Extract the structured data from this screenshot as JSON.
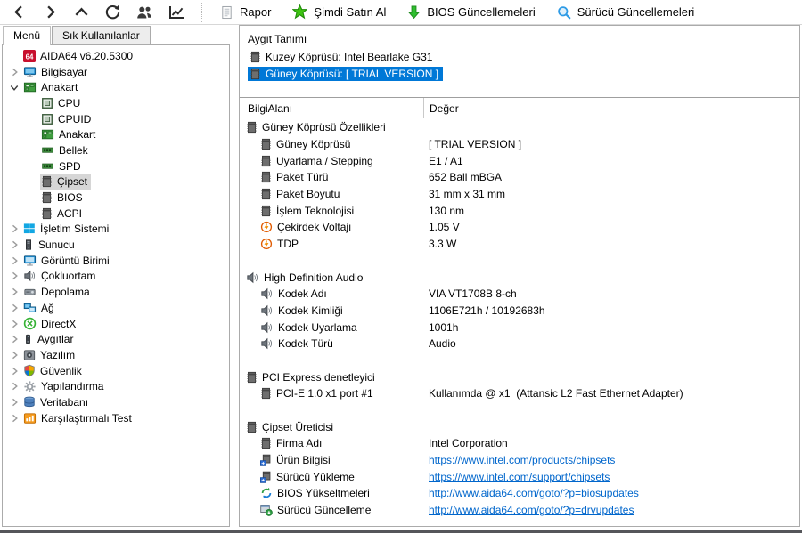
{
  "colors": {
    "accent": "#0078d7",
    "link": "#0066cc",
    "selection_inactive": "#d6d6d6"
  },
  "toolbar": {
    "nav_icons": [
      {
        "name": "back"
      },
      {
        "name": "forward"
      },
      {
        "name": "up"
      },
      {
        "name": "refresh"
      },
      {
        "name": "users"
      },
      {
        "name": "chart"
      }
    ],
    "buttons": [
      {
        "name": "report-button",
        "icon": "report",
        "label": "Rapor"
      },
      {
        "name": "buy-now-button",
        "icon": "buy",
        "label": "Şimdi Satın Al"
      },
      {
        "name": "bios-updates-button",
        "icon": "download",
        "label": "BIOS Güncellemeleri"
      },
      {
        "name": "driver-updates-button",
        "icon": "search",
        "label": "Sürücü Güncellemeleri"
      }
    ]
  },
  "sidebar": {
    "tabs": [
      {
        "label": "Menü",
        "active": true
      },
      {
        "label": "Sık Kullanılanlar",
        "active": false
      }
    ],
    "tree": [
      {
        "label": "AIDA64 v6.20.5300",
        "icon": "aida64",
        "level": 0,
        "expander": "none"
      },
      {
        "label": "Bilgisayar",
        "icon": "computer",
        "level": 0,
        "expander": "collapsed"
      },
      {
        "label": "Anakart",
        "icon": "motherboard",
        "level": 0,
        "expander": "expanded"
      },
      {
        "label": "CPU",
        "icon": "cpu",
        "level": 1,
        "expander": "none"
      },
      {
        "label": "CPUID",
        "icon": "cpu",
        "level": 1,
        "expander": "none"
      },
      {
        "label": "Anakart",
        "icon": "motherboard",
        "level": 1,
        "expander": "none"
      },
      {
        "label": "Bellek",
        "icon": "memory",
        "level": 1,
        "expander": "none"
      },
      {
        "label": "SPD",
        "icon": "memory",
        "level": 1,
        "expander": "none"
      },
      {
        "label": "Çipset",
        "icon": "chip",
        "level": 1,
        "expander": "none",
        "selected": true
      },
      {
        "label": "BIOS",
        "icon": "chip",
        "level": 1,
        "expander": "none"
      },
      {
        "label": "ACPI",
        "icon": "chip",
        "level": 1,
        "expander": "none"
      },
      {
        "label": "İşletim Sistemi",
        "icon": "windows",
        "level": 0,
        "expander": "collapsed"
      },
      {
        "label": "Sunucu",
        "icon": "server",
        "level": 0,
        "expander": "collapsed"
      },
      {
        "label": "Görüntü Birimi",
        "icon": "display",
        "level": 0,
        "expander": "collapsed"
      },
      {
        "label": "Çokluortam",
        "icon": "speaker",
        "level": 0,
        "expander": "collapsed"
      },
      {
        "label": "Depolama",
        "icon": "storage",
        "level": 0,
        "expander": "collapsed"
      },
      {
        "label": "Ağ",
        "icon": "network",
        "level": 0,
        "expander": "collapsed"
      },
      {
        "label": "DirectX",
        "icon": "directx",
        "level": 0,
        "expander": "collapsed"
      },
      {
        "label": "Aygıtlar",
        "icon": "devices",
        "level": 0,
        "expander": "collapsed"
      },
      {
        "label": "Yazılım",
        "icon": "software",
        "level": 0,
        "expander": "collapsed"
      },
      {
        "label": "Güvenlik",
        "icon": "security",
        "level": 0,
        "expander": "collapsed"
      },
      {
        "label": "Yapılandırma",
        "icon": "config",
        "level": 0,
        "expander": "collapsed"
      },
      {
        "label": "Veritabanı",
        "icon": "database",
        "level": 0,
        "expander": "collapsed"
      },
      {
        "label": "Karşılaştırmalı Test",
        "icon": "benchmark",
        "level": 0,
        "expander": "collapsed"
      }
    ]
  },
  "main": {
    "device_header": "Aygıt Tanımı",
    "devices": [
      {
        "icon": "chip",
        "label": "Kuzey Köprüsü: Intel Bearlake G31",
        "selected": false
      },
      {
        "icon": "chip",
        "label": "Güney Köprüsü: [ TRIAL VERSION ]",
        "selected": true
      }
    ],
    "columns": [
      "BilgiAlanı",
      "Değer"
    ],
    "sections": [
      {
        "icon": "chip",
        "title": "Güney Köprüsü Özellikleri",
        "rows": [
          {
            "icon": "chip",
            "label": "Güney Köprüsü",
            "value": "[ TRIAL VERSION ]"
          },
          {
            "icon": "chip",
            "label": "Uyarlama / Stepping",
            "value": "E1 / A1"
          },
          {
            "icon": "chip",
            "label": "Paket Türü",
            "value": "652 Ball mBGA"
          },
          {
            "icon": "chip",
            "label": "Paket Boyutu",
            "value": "31 mm x 31 mm"
          },
          {
            "icon": "chip",
            "label": "İşlem Teknolojisi",
            "value": "130 nm"
          },
          {
            "icon": "voltage",
            "label": "Çekirdek Voltajı",
            "value": "1.05 V"
          },
          {
            "icon": "voltage",
            "label": "TDP",
            "value": "3.3 W"
          }
        ]
      },
      {
        "icon": "speaker",
        "title": "High Definition Audio",
        "rows": [
          {
            "icon": "speaker",
            "label": "Kodek Adı",
            "value": "VIA VT1708B 8-ch"
          },
          {
            "icon": "speaker",
            "label": "Kodek Kimliği",
            "value": "1106E721h / 10192683h"
          },
          {
            "icon": "speaker",
            "label": "Kodek Uyarlama",
            "value": "1001h"
          },
          {
            "icon": "speaker",
            "label": "Kodek Türü",
            "value": "Audio"
          }
        ]
      },
      {
        "icon": "chip",
        "title": "PCI Express denetleyici",
        "rows": [
          {
            "icon": "chip",
            "label": "PCI-E 1.0 x1 port #1",
            "value": "Kullanımda @ x1  (Attansic L2 Fast Ethernet Adapter)"
          }
        ]
      },
      {
        "icon": "chip",
        "title": "Çipset Üreticisi",
        "rows": [
          {
            "icon": "chip",
            "label": "Firma Adı",
            "value": "Intel Corporation"
          },
          {
            "icon": "link-chip",
            "label": "Ürün Bilgisi",
            "value": "https://www.intel.com/products/chipsets",
            "link": true
          },
          {
            "icon": "link-chip",
            "label": "Sürücü Yükleme",
            "value": "https://www.intel.com/support/chipsets",
            "link": true
          },
          {
            "icon": "bios-update",
            "label": "BIOS Yükseltmeleri",
            "value": "http://www.aida64.com/goto/?p=biosupdates",
            "link": true
          },
          {
            "icon": "driver-update",
            "label": "Sürücü Güncelleme",
            "value": "http://www.aida64.com/goto/?p=drvupdates",
            "link": true
          }
        ]
      }
    ]
  }
}
